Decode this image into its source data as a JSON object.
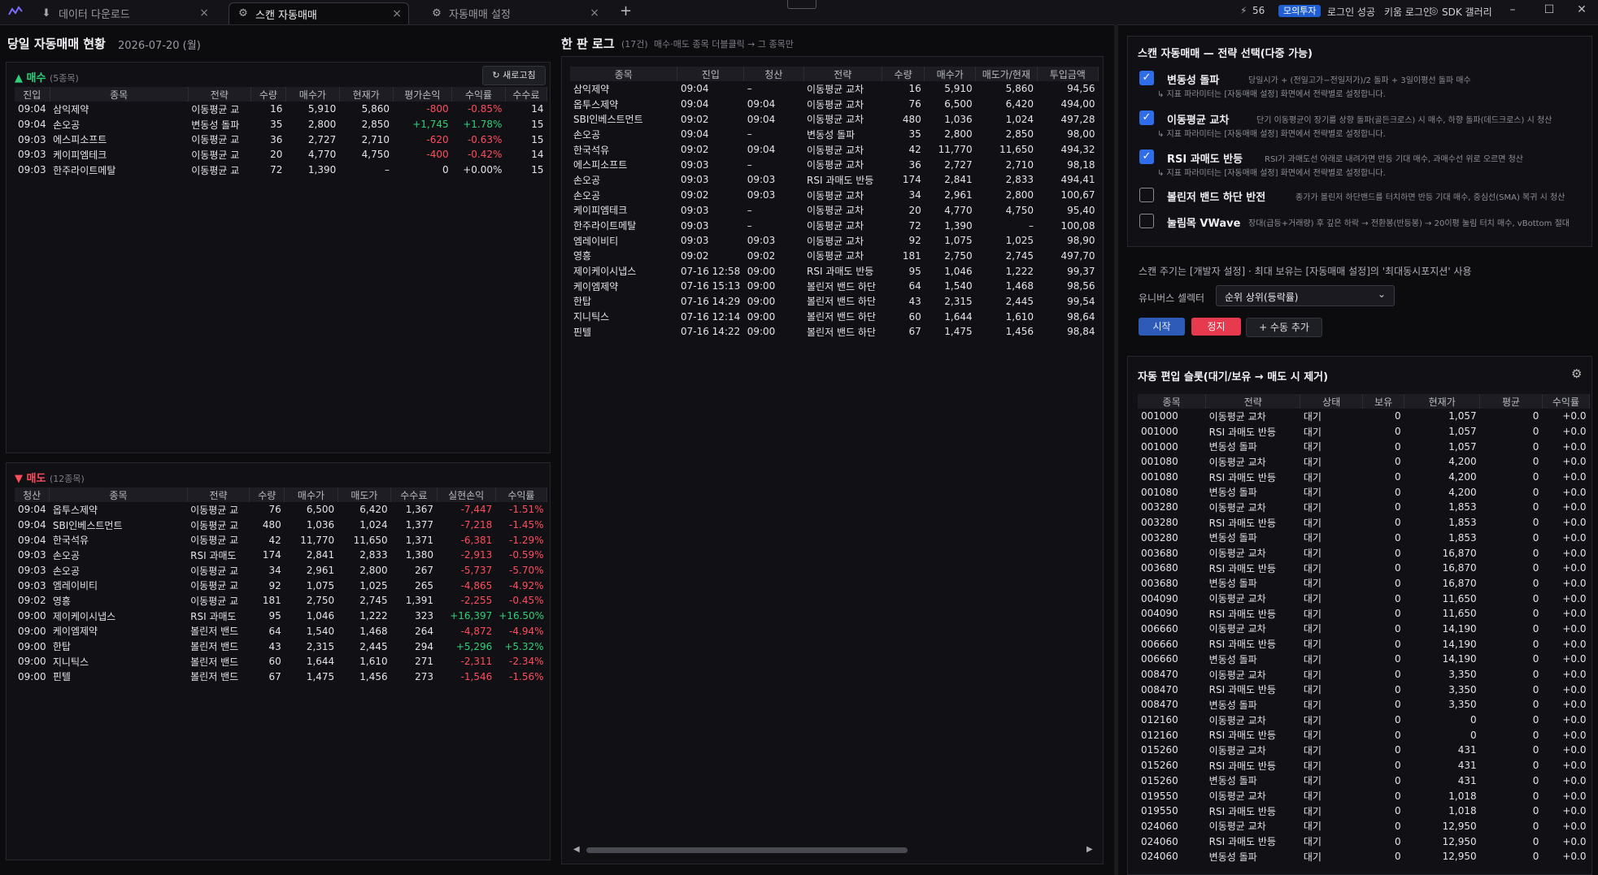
{
  "titlebar": {
    "tabs": [
      {
        "label": "데이터 다운로드",
        "icon": "download-icon",
        "active": false
      },
      {
        "label": "스캔 자동매매",
        "icon": "robot-icon",
        "active": true
      },
      {
        "label": "자동매매 설정",
        "icon": "gear-icon",
        "active": false
      }
    ],
    "add_tab": "+",
    "count": "56",
    "mode_badge": "모의투자",
    "login_status": "로그인 성공",
    "kiwoom_login": "키움 로그인",
    "sdk_gallery": "SDK 갤러리"
  },
  "summary": {
    "title": "당일 자동매매 현황",
    "date": "2026-07-20 (월)",
    "buy": {
      "label": "매수",
      "count": "(5종목)",
      "refresh": "새로고침",
      "columns": [
        "진입",
        "종목",
        "전략",
        "수량",
        "매수가",
        "현재가",
        "평가손익",
        "수익률",
        "수수료"
      ],
      "rows": [
        [
          "09:04",
          "삼익제약",
          "이동평균 교",
          "16",
          "5,910",
          "5,860",
          "-800",
          "-0.85%",
          "14"
        ],
        [
          "09:04",
          "손오공",
          "변동성 돌파",
          "35",
          "2,800",
          "2,850",
          "+1,745",
          "+1.78%",
          "15"
        ],
        [
          "09:03",
          "에스피소프트",
          "이동평균 교",
          "36",
          "2,727",
          "2,710",
          "-620",
          "-0.63%",
          "15"
        ],
        [
          "09:03",
          "케이피엠테크",
          "이동평균 교",
          "20",
          "4,770",
          "4,750",
          "-400",
          "-0.42%",
          "14"
        ],
        [
          "09:03",
          "한주라이트메탈",
          "이동평균 교",
          "72",
          "1,390",
          "–",
          "0",
          "+0.00%",
          "15"
        ]
      ]
    },
    "sell": {
      "label": "매도",
      "count": "(12종목)",
      "columns": [
        "청산",
        "종목",
        "전략",
        "수량",
        "매수가",
        "매도가",
        "수수료",
        "실현손익",
        "수익률"
      ],
      "rows": [
        [
          "09:04",
          "옵투스제약",
          "이동평균 교",
          "76",
          "6,500",
          "6,420",
          "1,367",
          "-7,447",
          "-1.51%"
        ],
        [
          "09:04",
          "SBI인베스트먼트",
          "이동평균 교",
          "480",
          "1,036",
          "1,024",
          "1,377",
          "-7,218",
          "-1.45%"
        ],
        [
          "09:04",
          "한국석유",
          "이동평균 교",
          "42",
          "11,770",
          "11,650",
          "1,371",
          "-6,381",
          "-1.29%"
        ],
        [
          "09:03",
          "손오공",
          "RSI 과매도",
          "174",
          "2,841",
          "2,833",
          "1,380",
          "-2,913",
          "-0.59%"
        ],
        [
          "09:03",
          "손오공",
          "이동평균 교",
          "34",
          "2,961",
          "2,800",
          "267",
          "-5,737",
          "-5.70%"
        ],
        [
          "09:03",
          "엠레이비티",
          "이동평균 교",
          "92",
          "1,075",
          "1,025",
          "265",
          "-4,865",
          "-4.92%"
        ],
        [
          "09:02",
          "영흥",
          "이동평균 교",
          "181",
          "2,750",
          "2,745",
          "1,391",
          "-2,255",
          "-0.45%"
        ],
        [
          "09:00",
          "제이케이시냅스",
          "RSI 과매도",
          "95",
          "1,046",
          "1,222",
          "323",
          "+16,397",
          "+16.50%"
        ],
        [
          "09:00",
          "케이엠제약",
          "볼린저 밴드",
          "64",
          "1,540",
          "1,468",
          "264",
          "-4,872",
          "-4.94%"
        ],
        [
          "09:00",
          "한탑",
          "볼린저 밴드",
          "43",
          "2,315",
          "2,445",
          "294",
          "+5,296",
          "+5.32%"
        ],
        [
          "09:00",
          "지니틱스",
          "볼린저 밴드",
          "60",
          "1,644",
          "1,610",
          "271",
          "-2,311",
          "-2.34%"
        ],
        [
          "09:00",
          "핀텔",
          "볼린저 밴드",
          "67",
          "1,475",
          "1,456",
          "273",
          "-1,546",
          "-1.56%"
        ]
      ]
    }
  },
  "log": {
    "title": "한 판 로그",
    "count": "(17건)",
    "hint": "매수·매도 종목 더블클릭 → 그 종목만",
    "columns": [
      "종목",
      "진입",
      "청산",
      "전략",
      "수량",
      "매수가",
      "매도가/현재",
      "투입금액"
    ],
    "rows": [
      [
        "삼익제약",
        "09:04",
        "–",
        "이동평균 교차",
        "16",
        "5,910",
        "5,860",
        "94,56"
      ],
      [
        "옵투스제약",
        "09:04",
        "09:04",
        "이동평균 교차",
        "76",
        "6,500",
        "6,420",
        "494,00"
      ],
      [
        "SBI인베스트먼트",
        "09:02",
        "09:04",
        "이동평균 교차",
        "480",
        "1,036",
        "1,024",
        "497,28"
      ],
      [
        "손오공",
        "09:04",
        "–",
        "변동성 돌파",
        "35",
        "2,800",
        "2,850",
        "98,00"
      ],
      [
        "한국석유",
        "09:02",
        "09:04",
        "이동평균 교차",
        "42",
        "11,770",
        "11,650",
        "494,32"
      ],
      [
        "에스피소프트",
        "09:03",
        "–",
        "이동평균 교차",
        "36",
        "2,727",
        "2,710",
        "98,18"
      ],
      [
        "손오공",
        "09:03",
        "09:03",
        "RSI 과매도 반등",
        "174",
        "2,841",
        "2,833",
        "494,41"
      ],
      [
        "손오공",
        "09:02",
        "09:03",
        "이동평균 교차",
        "34",
        "2,961",
        "2,800",
        "100,67"
      ],
      [
        "케이피엠테크",
        "09:03",
        "–",
        "이동평균 교차",
        "20",
        "4,770",
        "4,750",
        "95,40"
      ],
      [
        "한주라이트메탈",
        "09:03",
        "–",
        "이동평균 교차",
        "72",
        "1,390",
        "–",
        "100,08"
      ],
      [
        "엠레이비티",
        "09:03",
        "09:03",
        "이동평균 교차",
        "92",
        "1,075",
        "1,025",
        "98,90"
      ],
      [
        "영흥",
        "09:02",
        "09:02",
        "이동평균 교차",
        "181",
        "2,750",
        "2,745",
        "497,70"
      ],
      [
        "제이케이시냅스",
        "07-16 12:58",
        "09:00",
        "RSI 과매도 반등",
        "95",
        "1,046",
        "1,222",
        "99,37"
      ],
      [
        "케이엠제약",
        "07-16 15:13",
        "09:00",
        "볼린저 밴드 하단",
        "64",
        "1,540",
        "1,468",
        "98,56"
      ],
      [
        "한탑",
        "07-16 14:29",
        "09:00",
        "볼린저 밴드 하단",
        "43",
        "2,315",
        "2,445",
        "99,54"
      ],
      [
        "지니틱스",
        "07-16 12:14",
        "09:00",
        "볼린저 밴드 하단",
        "60",
        "1,644",
        "1,610",
        "98,64"
      ],
      [
        "핀텔",
        "07-16 14:22",
        "09:00",
        "볼린저 밴드 하단",
        "67",
        "1,475",
        "1,456",
        "98,84"
      ]
    ]
  },
  "strategy": {
    "title": "스캔 자동매매 — 전략 선택(다중 가능)",
    "items": [
      {
        "name": "변동성 돌파",
        "checked": true,
        "desc": "당일시가 + (전일고가−전일저가)/2 돌파 + 3일이평선 돌파 매수",
        "hint": "↳ 지표 파라미터는 [자동매매 설정] 화면에서 전략별로 설정합니다."
      },
      {
        "name": "이동평균 교차",
        "checked": true,
        "desc": "단기 이동평균이 장기를 상향 돌파(골든크로스) 시 매수, 하향 돌파(데드크로스) 시 청산",
        "hint": "↳ 지표 파라미터는 [자동매매 설정] 화면에서 전략별로 설정합니다."
      },
      {
        "name": "RSI 과매도 반등",
        "checked": true,
        "desc": "RSI가 과매도선 아래로 내려가면 반등 기대 매수, 과매수선 위로 오르면 청산",
        "hint": "↳ 지표 파라미터는 [자동매매 설정] 화면에서 전략별로 설정합니다."
      },
      {
        "name": "볼린저 밴드 하단 반전",
        "checked": false,
        "desc": "종가가 볼린저 하단밴드를 터치하면 반등 기대 매수, 중심선(SMA) 복귀 시 청산",
        "hint": ""
      },
      {
        "name": "눌림목 VWave",
        "checked": false,
        "desc": "장대(급등+거래량) 후 깊은 하락 → 전환봉(반등봉) → 20이평 눌림 터치 매수, vBottom 절대",
        "hint": ""
      }
    ],
    "scan_note": "스캔 주기는 [개발자 설정] · 최대 보유는 [자동매매 설정]의 '최대동시포지션' 사용",
    "universe_label": "유니버스 셀렉터",
    "universe_value": "순위 상위(등락률)",
    "start": "시작",
    "stop": "정지",
    "manual_add": "+ 수동 추가"
  },
  "slots": {
    "title": "자동 편입 슬롯(대기/보유 → 매도 시 제거)",
    "columns": [
      "종목",
      "전략",
      "상태",
      "보유",
      "현재가",
      "평균",
      "수익률"
    ],
    "rows": [
      [
        "001000",
        "이동평균 교차",
        "대기",
        "0",
        "1,057",
        "0",
        "+0.0"
      ],
      [
        "001000",
        "RSI 과매도 반등",
        "대기",
        "0",
        "1,057",
        "0",
        "+0.0"
      ],
      [
        "001000",
        "변동성 돌파",
        "대기",
        "0",
        "1,057",
        "0",
        "+0.0"
      ],
      [
        "001080",
        "이동평균 교차",
        "대기",
        "0",
        "4,200",
        "0",
        "+0.0"
      ],
      [
        "001080",
        "RSI 과매도 반등",
        "대기",
        "0",
        "4,200",
        "0",
        "+0.0"
      ],
      [
        "001080",
        "변동성 돌파",
        "대기",
        "0",
        "4,200",
        "0",
        "+0.0"
      ],
      [
        "003280",
        "이동평균 교차",
        "대기",
        "0",
        "1,853",
        "0",
        "+0.0"
      ],
      [
        "003280",
        "RSI 과매도 반등",
        "대기",
        "0",
        "1,853",
        "0",
        "+0.0"
      ],
      [
        "003280",
        "변동성 돌파",
        "대기",
        "0",
        "1,853",
        "0",
        "+0.0"
      ],
      [
        "003680",
        "이동평균 교차",
        "대기",
        "0",
        "16,870",
        "0",
        "+0.0"
      ],
      [
        "003680",
        "RSI 과매도 반등",
        "대기",
        "0",
        "16,870",
        "0",
        "+0.0"
      ],
      [
        "003680",
        "변동성 돌파",
        "대기",
        "0",
        "16,870",
        "0",
        "+0.0"
      ],
      [
        "004090",
        "이동평균 교차",
        "대기",
        "0",
        "11,650",
        "0",
        "+0.0"
      ],
      [
        "004090",
        "RSI 과매도 반등",
        "대기",
        "0",
        "11,650",
        "0",
        "+0.0"
      ],
      [
        "006660",
        "이동평균 교차",
        "대기",
        "0",
        "14,190",
        "0",
        "+0.0"
      ],
      [
        "006660",
        "RSI 과매도 반등",
        "대기",
        "0",
        "14,190",
        "0",
        "+0.0"
      ],
      [
        "006660",
        "변동성 돌파",
        "대기",
        "0",
        "14,190",
        "0",
        "+0.0"
      ],
      [
        "008470",
        "이동평균 교차",
        "대기",
        "0",
        "3,350",
        "0",
        "+0.0"
      ],
      [
        "008470",
        "RSI 과매도 반등",
        "대기",
        "0",
        "3,350",
        "0",
        "+0.0"
      ],
      [
        "008470",
        "변동성 돌파",
        "대기",
        "0",
        "3,350",
        "0",
        "+0.0"
      ],
      [
        "012160",
        "이동평균 교차",
        "대기",
        "0",
        "0",
        "0",
        "+0.0"
      ],
      [
        "012160",
        "RSI 과매도 반등",
        "대기",
        "0",
        "0",
        "0",
        "+0.0"
      ],
      [
        "015260",
        "이동평균 교차",
        "대기",
        "0",
        "431",
        "0",
        "+0.0"
      ],
      [
        "015260",
        "RSI 과매도 반등",
        "대기",
        "0",
        "431",
        "0",
        "+0.0"
      ],
      [
        "015260",
        "변동성 돌파",
        "대기",
        "0",
        "431",
        "0",
        "+0.0"
      ],
      [
        "019550",
        "이동평균 교차",
        "대기",
        "0",
        "1,018",
        "0",
        "+0.0"
      ],
      [
        "019550",
        "RSI 과매도 반등",
        "대기",
        "0",
        "1,018",
        "0",
        "+0.0"
      ],
      [
        "024060",
        "이동평균 교차",
        "대기",
        "0",
        "12,950",
        "0",
        "+0.0"
      ],
      [
        "024060",
        "RSI 과매도 반등",
        "대기",
        "0",
        "12,950",
        "0",
        "+0.0"
      ],
      [
        "024060",
        "변동성 돌파",
        "대기",
        "0",
        "12,950",
        "0",
        "+0.0"
      ]
    ]
  },
  "colors": {
    "accent": "#2f6ee8",
    "negative": "#ff4d5e",
    "positive": "#2fd07a",
    "stop": "#e83a4f"
  }
}
